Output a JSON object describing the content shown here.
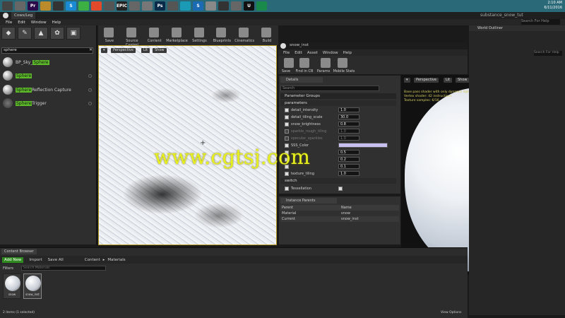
{
  "taskbar": {
    "apps": [
      "",
      "",
      "Pr",
      "",
      "",
      "S",
      "",
      "",
      "",
      "EPIC",
      "",
      "",
      "Ps",
      "",
      "",
      "S",
      "",
      "",
      "",
      "U",
      ""
    ],
    "time": "2:10 AM",
    "date": "6/11/2016",
    "window_title": "substance_snow_tut",
    "search_help": "Search For Help"
  },
  "main_tab": "Cows/Leg",
  "menu": [
    "File",
    "Edit",
    "Window",
    "Help"
  ],
  "modes": {
    "title": "Modes",
    "search_value": "sphere",
    "items": [
      {
        "prefix": "BP_Sky_",
        "highlight": "Sphere",
        "suffix": ""
      },
      {
        "prefix": "",
        "highlight": "Sphere",
        "suffix": ""
      },
      {
        "prefix": "",
        "highlight": "Sphere",
        "suffix": " Reflection Capture"
      },
      {
        "prefix": "",
        "highlight": "Sphere",
        "suffix": " Trigger"
      }
    ]
  },
  "toolbar": [
    "Save",
    "Source Control",
    "Content",
    "Marketplace",
    "Settings",
    "Blueprints",
    "Cinematics",
    "Build",
    "",
    ""
  ],
  "viewport": {
    "perspective": "Perspective",
    "lit": "Lit",
    "show": "Show"
  },
  "material_editor": {
    "tab": "snow_inst",
    "menu": [
      "File",
      "Edit",
      "Asset",
      "Window",
      "Help"
    ],
    "toolbar": [
      "Save",
      "Find in CB",
      "Params",
      "Mobile Stats"
    ],
    "details_tab": "Details",
    "search_placeholder": "Search",
    "parameter_groups": "Parameter Groups",
    "group_parameters": "parameters",
    "params": [
      {
        "name": "detail_intensity",
        "value": "1.0",
        "enabled": true
      },
      {
        "name": "detail_tiling_scale",
        "value": "30.0",
        "enabled": true
      },
      {
        "name": "snow_brightness",
        "value": "0.8",
        "enabled": true
      },
      {
        "name": "sparkle_rough_tiling",
        "value": "1.0",
        "enabled": false
      },
      {
        "name": "specular_sparkles",
        "value": "1.0",
        "enabled": false
      },
      {
        "name": "SSS_Color",
        "value": "",
        "enabled": true
      },
      {
        "name": "",
        "value": "0.5",
        "enabled": true
      },
      {
        "name": "",
        "value": "0.2",
        "enabled": true
      },
      {
        "name": "",
        "value": "0.1",
        "enabled": true
      },
      {
        "name": "texture_tiling",
        "value": "1.0",
        "enabled": true
      }
    ],
    "group_switch": "switch",
    "switch_param": "Tessellation",
    "instance_parents_tab": "Instance Parents",
    "inst_header": [
      "Parent",
      "Name"
    ],
    "inst_rows": [
      [
        "Material",
        "snow"
      ],
      [
        "Current",
        "snow_inst"
      ]
    ]
  },
  "preview": {
    "perspective": "Perspective",
    "lit": "Lit",
    "show": "Show",
    "info": [
      "Base pass shader with only dynamic lighting: 99 instructions",
      "Vertex shader: 42 instructions",
      "Texture samples: 6/16"
    ]
  },
  "outliner": {
    "title": "World Outliner",
    "search": "Search For Help"
  },
  "content_browser": {
    "tab": "Content Browser",
    "add_new": "Add New",
    "import": "Import",
    "save_all": "Save All",
    "path": [
      "Content",
      "Materials"
    ],
    "filters": "Filters",
    "search_placeholder": "Search Materials",
    "assets": [
      "snow",
      "snow_inst"
    ],
    "status": "2 items (1 selected)",
    "view_options": "View Options"
  },
  "watermark": "www.cgtsj.com"
}
